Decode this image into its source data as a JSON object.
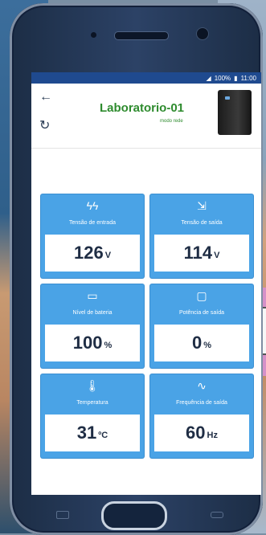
{
  "status_bar": {
    "battery": "100%",
    "time": "11:00"
  },
  "app": {
    "title": "Laboratorio-01",
    "subtitle": "modo rede"
  },
  "cards": [
    {
      "icon": "ϟϟ",
      "icon_name": "input-voltage-icon",
      "label": "Tensão de entrada",
      "value": "126",
      "unit": "V"
    },
    {
      "icon": "⇲",
      "icon_name": "output-voltage-icon",
      "label": "Tensão de saída",
      "value": "114",
      "unit": "V"
    },
    {
      "icon": "▭",
      "icon_name": "battery-icon",
      "label": "Nível de bateria",
      "value": "100",
      "unit": "%"
    },
    {
      "icon": "▢",
      "icon_name": "monitor-icon",
      "label": "Potência de saída",
      "value": "0",
      "unit": "%"
    },
    {
      "icon": "🌡",
      "icon_name": "thermometer-icon",
      "label": "Temperatura",
      "value": "31",
      "unit": "ºC"
    },
    {
      "icon": "∿",
      "icon_name": "wave-icon",
      "label": "Frequência de saída",
      "value": "60",
      "unit": "Hz"
    }
  ],
  "colors": {
    "card_blue": "#4aa3e6",
    "title_green": "#2e8b2e",
    "status_bar_blue": "#1f4a8f"
  }
}
